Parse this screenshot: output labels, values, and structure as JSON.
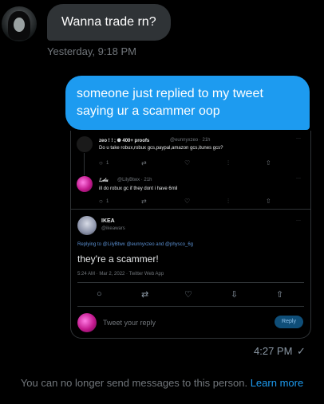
{
  "incoming": {
    "message": "Wanna trade rn?",
    "timestamp": "Yesterday, 9:18 PM"
  },
  "outgoing": {
    "message": "someone just replied to my tweet saying ur a scammer oop",
    "timestamp": "4:27 PM",
    "status_icon": "check-icon"
  },
  "screenshot": {
    "tweet1": {
      "author": "zeo ! ! ; ❁ 400+ proofs",
      "handle": "@eunnyxzeo · 21h",
      "text": "Do u take robux,robux gcs,paypal,amazon gcs,itunes gcs?",
      "reply_count": "1"
    },
    "tweet2": {
      "author": "ℒ𝒾𝓁𝒶",
      "handle": "@LilyBtwx · 21h",
      "text": "ill do robux gc if they dont i have 6mil",
      "reply_count": "1"
    },
    "tweet3": {
      "author": "IKEA",
      "handle": "@ikeawars",
      "replying_to": "Replying to @LilyBtwx @eunnyxzeo and @physco_6g",
      "text": "they're a scammer!",
      "meta": "5:24 AM · Mar 2, 2022 · Twitter Web App"
    },
    "reply_box": {
      "placeholder": "Tweet your reply",
      "button": "Reply"
    }
  },
  "footer": {
    "notice": "You can no longer send messages to this person.",
    "link": "Learn more"
  }
}
